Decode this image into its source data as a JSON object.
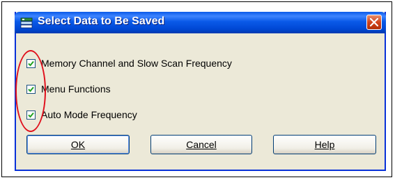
{
  "dialog": {
    "title": "Select Data to Be Saved",
    "title_icon": "save-data-icon",
    "close_icon": "close-icon"
  },
  "options": [
    {
      "label": "Memory Channel and Slow Scan Frequency",
      "checked": true
    },
    {
      "label": "Menu Functions",
      "checked": true
    },
    {
      "label": "Auto Mode Frequency",
      "checked": true
    }
  ],
  "buttons": {
    "ok_label": "OK",
    "cancel_label": "Cancel",
    "help_label": "Help"
  },
  "colors": {
    "titlebar": "#0a5ae8",
    "window_bg": "#ece9d8",
    "highlight_oval": "#e0101c",
    "checkmark": "#21a121"
  }
}
